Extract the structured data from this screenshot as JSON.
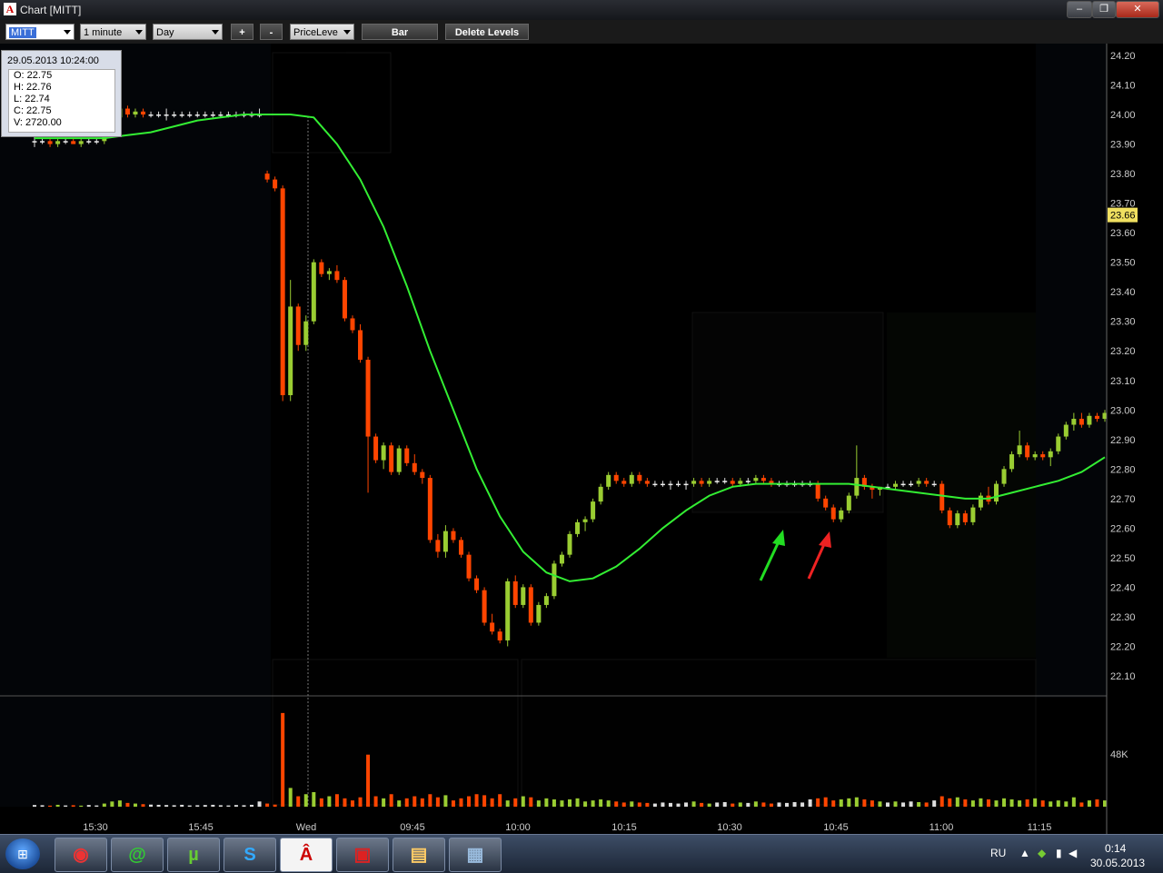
{
  "window": {
    "title": "Chart [MITT]",
    "app_icon": "A"
  },
  "toolbar": {
    "symbol": "MITT",
    "interval": "1 minute",
    "period": "Day",
    "zoom_in": "+",
    "zoom_out": "-",
    "mode": "PriceLeve",
    "bar_button": "Bar",
    "delete_levels_button": "Delete Levels"
  },
  "tooltip": {
    "datetime": "29.05.2013 10:24:00",
    "open": "O: 22.75",
    "high": "H: 22.76",
    "low": "L: 22.74",
    "close": "C: 22.75",
    "volume": "V: 2720.00"
  },
  "price_axis": {
    "labels": [
      "24.20",
      "24.10",
      "24.00",
      "23.90",
      "23.80",
      "23.70",
      "23.60",
      "23.50",
      "23.40",
      "23.30",
      "23.20",
      "23.10",
      "23.00",
      "22.90",
      "22.80",
      "22.70",
      "22.60",
      "22.50",
      "22.40",
      "22.30",
      "22.20",
      "22.10"
    ],
    "current_price": "23.66",
    "volume_label": "48K"
  },
  "time_axis": {
    "labels": [
      "15:30",
      "15:45",
      "Wed",
      "09:45",
      "10:00",
      "10:15",
      "10:30",
      "10:45",
      "11:00",
      "11:15"
    ]
  },
  "taskbar": {
    "language": "RU",
    "time": "0:14",
    "date": "30.05.2013"
  },
  "colors": {
    "up": "#9acd32",
    "down": "#ff4500",
    "ma": "#33ee33",
    "arrow_up": "#22dd22",
    "arrow_down": "#ee2222"
  },
  "chart_data": {
    "type": "candlestick",
    "symbol": "MITT",
    "ylim": [
      22.05,
      24.25
    ],
    "candles": [
      {
        "o": 23.91,
        "h": 23.93,
        "l": 23.89,
        "c": 23.91
      },
      {
        "o": 23.91,
        "h": 23.92,
        "l": 23.9,
        "c": 23.91
      },
      {
        "o": 23.91,
        "h": 23.92,
        "l": 23.89,
        "c": 23.9
      },
      {
        "o": 23.9,
        "h": 23.92,
        "l": 23.89,
        "c": 23.91
      },
      {
        "o": 23.91,
        "h": 23.92,
        "l": 23.9,
        "c": 23.91
      },
      {
        "o": 23.91,
        "h": 23.92,
        "l": 23.9,
        "c": 23.9
      },
      {
        "o": 23.9,
        "h": 23.92,
        "l": 23.89,
        "c": 23.91
      },
      {
        "o": 23.91,
        "h": 23.92,
        "l": 23.9,
        "c": 23.91
      },
      {
        "o": 23.91,
        "h": 23.92,
        "l": 23.9,
        "c": 23.91
      },
      {
        "o": 23.91,
        "h": 23.97,
        "l": 23.9,
        "c": 23.96
      },
      {
        "o": 23.96,
        "h": 24.0,
        "l": 23.95,
        "c": 23.99
      },
      {
        "o": 23.99,
        "h": 24.03,
        "l": 23.98,
        "c": 24.02
      },
      {
        "o": 24.02,
        "h": 24.03,
        "l": 23.99,
        "c": 24.0
      },
      {
        "o": 24.0,
        "h": 24.02,
        "l": 23.99,
        "c": 24.01
      },
      {
        "o": 24.01,
        "h": 24.02,
        "l": 23.99,
        "c": 24.0
      },
      {
        "o": 24.0,
        "h": 24.01,
        "l": 23.99,
        "c": 24.0
      },
      {
        "o": 24.0,
        "h": 24.01,
        "l": 23.99,
        "c": 24.0
      },
      {
        "o": 24.0,
        "h": 24.02,
        "l": 23.98,
        "c": 24.0
      },
      {
        "o": 24.0,
        "h": 24.01,
        "l": 23.99,
        "c": 24.0
      },
      {
        "o": 24.0,
        "h": 24.01,
        "l": 23.99,
        "c": 24.0
      },
      {
        "o": 24.0,
        "h": 24.01,
        "l": 23.99,
        "c": 24.0
      },
      {
        "o": 24.0,
        "h": 24.01,
        "l": 23.99,
        "c": 24.0
      },
      {
        "o": 24.0,
        "h": 24.01,
        "l": 23.99,
        "c": 24.0
      },
      {
        "o": 24.0,
        "h": 24.01,
        "l": 23.99,
        "c": 24.0
      },
      {
        "o": 24.0,
        "h": 24.01,
        "l": 23.99,
        "c": 24.0
      },
      {
        "o": 24.0,
        "h": 24.01,
        "l": 23.99,
        "c": 24.0
      },
      {
        "o": 24.0,
        "h": 24.01,
        "l": 23.99,
        "c": 24.0
      },
      {
        "o": 24.0,
        "h": 24.01,
        "l": 23.99,
        "c": 24.0
      },
      {
        "o": 24.0,
        "h": 24.01,
        "l": 23.99,
        "c": 24.0
      },
      {
        "o": 24.0,
        "h": 24.02,
        "l": 23.99,
        "c": 24.0
      },
      {
        "o": 23.8,
        "h": 23.81,
        "l": 23.77,
        "c": 23.78
      },
      {
        "o": 23.78,
        "h": 23.79,
        "l": 23.74,
        "c": 23.75
      },
      {
        "o": 23.75,
        "h": 23.76,
        "l": 23.03,
        "c": 23.05
      },
      {
        "o": 23.05,
        "h": 23.44,
        "l": 23.03,
        "c": 23.35
      },
      {
        "o": 23.35,
        "h": 23.36,
        "l": 23.2,
        "c": 23.22
      },
      {
        "o": 23.22,
        "h": 23.32,
        "l": 23.2,
        "c": 23.3
      },
      {
        "o": 23.3,
        "h": 23.51,
        "l": 23.29,
        "c": 23.5
      },
      {
        "o": 23.5,
        "h": 23.51,
        "l": 23.45,
        "c": 23.46
      },
      {
        "o": 23.46,
        "h": 23.48,
        "l": 23.44,
        "c": 23.47
      },
      {
        "o": 23.47,
        "h": 23.49,
        "l": 23.43,
        "c": 23.44
      },
      {
        "o": 23.44,
        "h": 23.45,
        "l": 23.3,
        "c": 23.31
      },
      {
        "o": 23.31,
        "h": 23.32,
        "l": 23.26,
        "c": 23.27
      },
      {
        "o": 23.27,
        "h": 23.29,
        "l": 23.16,
        "c": 23.17
      },
      {
        "o": 23.17,
        "h": 23.18,
        "l": 22.72,
        "c": 22.91
      },
      {
        "o": 22.91,
        "h": 22.92,
        "l": 22.82,
        "c": 22.83
      },
      {
        "o": 22.83,
        "h": 22.89,
        "l": 22.8,
        "c": 22.88
      },
      {
        "o": 22.88,
        "h": 22.89,
        "l": 22.78,
        "c": 22.79
      },
      {
        "o": 22.79,
        "h": 22.88,
        "l": 22.78,
        "c": 22.87
      },
      {
        "o": 22.87,
        "h": 22.88,
        "l": 22.81,
        "c": 22.82
      },
      {
        "o": 22.82,
        "h": 22.85,
        "l": 22.78,
        "c": 22.79
      },
      {
        "o": 22.79,
        "h": 22.8,
        "l": 22.75,
        "c": 22.77
      },
      {
        "o": 22.77,
        "h": 22.78,
        "l": 22.55,
        "c": 22.56
      },
      {
        "o": 22.56,
        "h": 22.58,
        "l": 22.5,
        "c": 22.52
      },
      {
        "o": 22.52,
        "h": 22.61,
        "l": 22.5,
        "c": 22.59
      },
      {
        "o": 22.59,
        "h": 22.6,
        "l": 22.55,
        "c": 22.56
      },
      {
        "o": 22.56,
        "h": 22.57,
        "l": 22.5,
        "c": 22.51
      },
      {
        "o": 22.51,
        "h": 22.52,
        "l": 22.42,
        "c": 22.43
      },
      {
        "o": 22.43,
        "h": 22.44,
        "l": 22.38,
        "c": 22.39
      },
      {
        "o": 22.39,
        "h": 22.4,
        "l": 22.27,
        "c": 22.28
      },
      {
        "o": 22.28,
        "h": 22.31,
        "l": 22.24,
        "c": 22.25
      },
      {
        "o": 22.25,
        "h": 22.26,
        "l": 22.21,
        "c": 22.22
      },
      {
        "o": 22.22,
        "h": 22.43,
        "l": 22.2,
        "c": 22.42
      },
      {
        "o": 22.42,
        "h": 22.44,
        "l": 22.33,
        "c": 22.34
      },
      {
        "o": 22.34,
        "h": 22.41,
        "l": 22.33,
        "c": 22.4
      },
      {
        "o": 22.4,
        "h": 22.41,
        "l": 22.27,
        "c": 22.28
      },
      {
        "o": 22.28,
        "h": 22.35,
        "l": 22.27,
        "c": 22.34
      },
      {
        "o": 22.34,
        "h": 22.38,
        "l": 22.33,
        "c": 22.37
      },
      {
        "o": 22.37,
        "h": 22.49,
        "l": 22.36,
        "c": 22.48
      },
      {
        "o": 22.48,
        "h": 22.52,
        "l": 22.47,
        "c": 22.51
      },
      {
        "o": 22.51,
        "h": 22.59,
        "l": 22.5,
        "c": 22.58
      },
      {
        "o": 22.58,
        "h": 22.63,
        "l": 22.57,
        "c": 22.62
      },
      {
        "o": 22.62,
        "h": 22.64,
        "l": 22.59,
        "c": 22.63
      },
      {
        "o": 22.63,
        "h": 22.7,
        "l": 22.62,
        "c": 22.69
      },
      {
        "o": 22.69,
        "h": 22.75,
        "l": 22.68,
        "c": 22.74
      },
      {
        "o": 22.74,
        "h": 22.79,
        "l": 22.73,
        "c": 22.78
      },
      {
        "o": 22.78,
        "h": 22.79,
        "l": 22.75,
        "c": 22.76
      },
      {
        "o": 22.76,
        "h": 22.77,
        "l": 22.74,
        "c": 22.75
      },
      {
        "o": 22.75,
        "h": 22.79,
        "l": 22.74,
        "c": 22.78
      },
      {
        "o": 22.78,
        "h": 22.79,
        "l": 22.75,
        "c": 22.76
      },
      {
        "o": 22.76,
        "h": 22.77,
        "l": 22.74,
        "c": 22.75
      },
      {
        "o": 22.75,
        "h": 22.76,
        "l": 22.74,
        "c": 22.75
      },
      {
        "o": 22.75,
        "h": 22.76,
        "l": 22.74,
        "c": 22.75
      },
      {
        "o": 22.75,
        "h": 22.76,
        "l": 22.73,
        "c": 22.75
      },
      {
        "o": 22.75,
        "h": 22.76,
        "l": 22.74,
        "c": 22.75
      },
      {
        "o": 22.75,
        "h": 22.76,
        "l": 22.73,
        "c": 22.75
      },
      {
        "o": 22.75,
        "h": 22.77,
        "l": 22.74,
        "c": 22.76
      },
      {
        "o": 22.76,
        "h": 22.77,
        "l": 22.74,
        "c": 22.75
      },
      {
        "o": 22.75,
        "h": 22.77,
        "l": 22.74,
        "c": 22.76
      },
      {
        "o": 22.76,
        "h": 22.77,
        "l": 22.75,
        "c": 22.76
      },
      {
        "o": 22.76,
        "h": 22.77,
        "l": 22.75,
        "c": 22.76
      },
      {
        "o": 22.76,
        "h": 22.77,
        "l": 22.74,
        "c": 22.75
      },
      {
        "o": 22.75,
        "h": 22.77,
        "l": 22.74,
        "c": 22.76
      },
      {
        "o": 22.76,
        "h": 22.77,
        "l": 22.75,
        "c": 22.76
      },
      {
        "o": 22.76,
        "h": 22.78,
        "l": 22.75,
        "c": 22.77
      },
      {
        "o": 22.77,
        "h": 22.78,
        "l": 22.75,
        "c": 22.76
      },
      {
        "o": 22.76,
        "h": 22.77,
        "l": 22.74,
        "c": 22.75
      },
      {
        "o": 22.75,
        "h": 22.76,
        "l": 22.74,
        "c": 22.75
      },
      {
        "o": 22.75,
        "h": 22.76,
        "l": 22.74,
        "c": 22.75
      },
      {
        "o": 22.75,
        "h": 22.76,
        "l": 22.74,
        "c": 22.75
      },
      {
        "o": 22.75,
        "h": 22.76,
        "l": 22.74,
        "c": 22.75
      },
      {
        "o": 22.75,
        "h": 22.76,
        "l": 22.74,
        "c": 22.75
      },
      {
        "o": 22.75,
        "h": 22.76,
        "l": 22.69,
        "c": 22.7
      },
      {
        "o": 22.7,
        "h": 22.71,
        "l": 22.66,
        "c": 22.67
      },
      {
        "o": 22.67,
        "h": 22.68,
        "l": 22.62,
        "c": 22.63
      },
      {
        "o": 22.63,
        "h": 22.67,
        "l": 22.62,
        "c": 22.66
      },
      {
        "o": 22.66,
        "h": 22.72,
        "l": 22.65,
        "c": 22.71
      },
      {
        "o": 22.71,
        "h": 22.88,
        "l": 22.7,
        "c": 22.77
      },
      {
        "o": 22.77,
        "h": 22.78,
        "l": 22.73,
        "c": 22.74
      },
      {
        "o": 22.74,
        "h": 22.75,
        "l": 22.7,
        "c": 22.73
      },
      {
        "o": 22.73,
        "h": 22.74,
        "l": 22.71,
        "c": 22.74
      },
      {
        "o": 22.74,
        "h": 22.75,
        "l": 22.73,
        "c": 22.74
      },
      {
        "o": 22.74,
        "h": 22.76,
        "l": 22.73,
        "c": 22.75
      },
      {
        "o": 22.75,
        "h": 22.76,
        "l": 22.74,
        "c": 22.75
      },
      {
        "o": 22.75,
        "h": 22.76,
        "l": 22.74,
        "c": 22.75
      },
      {
        "o": 22.75,
        "h": 22.77,
        "l": 22.74,
        "c": 22.76
      },
      {
        "o": 22.76,
        "h": 22.77,
        "l": 22.74,
        "c": 22.75
      },
      {
        "o": 22.75,
        "h": 22.76,
        "l": 22.74,
        "c": 22.75
      },
      {
        "o": 22.75,
        "h": 22.76,
        "l": 22.65,
        "c": 22.66
      },
      {
        "o": 22.66,
        "h": 22.67,
        "l": 22.6,
        "c": 22.61
      },
      {
        "o": 22.61,
        "h": 22.66,
        "l": 22.6,
        "c": 22.65
      },
      {
        "o": 22.65,
        "h": 22.66,
        "l": 22.61,
        "c": 22.62
      },
      {
        "o": 22.62,
        "h": 22.68,
        "l": 22.61,
        "c": 22.67
      },
      {
        "o": 22.67,
        "h": 22.72,
        "l": 22.66,
        "c": 22.71
      },
      {
        "o": 22.71,
        "h": 22.74,
        "l": 22.68,
        "c": 22.69
      },
      {
        "o": 22.69,
        "h": 22.76,
        "l": 22.68,
        "c": 22.75
      },
      {
        "o": 22.75,
        "h": 22.81,
        "l": 22.74,
        "c": 22.8
      },
      {
        "o": 22.8,
        "h": 22.86,
        "l": 22.79,
        "c": 22.85
      },
      {
        "o": 22.85,
        "h": 22.93,
        "l": 22.84,
        "c": 22.88
      },
      {
        "o": 22.88,
        "h": 22.89,
        "l": 22.83,
        "c": 22.84
      },
      {
        "o": 22.84,
        "h": 22.86,
        "l": 22.83,
        "c": 22.85
      },
      {
        "o": 22.85,
        "h": 22.86,
        "l": 22.83,
        "c": 22.84
      },
      {
        "o": 22.84,
        "h": 22.87,
        "l": 22.81,
        "c": 22.86
      },
      {
        "o": 22.86,
        "h": 22.92,
        "l": 22.85,
        "c": 22.91
      },
      {
        "o": 22.91,
        "h": 22.96,
        "l": 22.9,
        "c": 22.95
      },
      {
        "o": 22.95,
        "h": 22.99,
        "l": 22.93,
        "c": 22.97
      },
      {
        "o": 22.97,
        "h": 22.99,
        "l": 22.94,
        "c": 22.95
      },
      {
        "o": 22.95,
        "h": 22.99,
        "l": 22.94,
        "c": 22.98
      },
      {
        "o": 22.98,
        "h": 22.99,
        "l": 22.96,
        "c": 22.97
      },
      {
        "o": 22.97,
        "h": 23.0,
        "l": 22.96,
        "c": 22.99
      }
    ],
    "moving_average": [
      23.92,
      23.92,
      23.92,
      23.92,
      23.93,
      23.94,
      23.96,
      23.98,
      23.99,
      24.0,
      24.0,
      24.0,
      23.99,
      23.9,
      23.78,
      23.62,
      23.42,
      23.2,
      23.0,
      22.8,
      22.64,
      22.52,
      22.45,
      22.42,
      22.43,
      22.47,
      22.53,
      22.6,
      22.66,
      22.71,
      22.74,
      22.75,
      22.75,
      22.75,
      22.75,
      22.75,
      22.74,
      22.73,
      22.72,
      22.71,
      22.7,
      22.7,
      22.72,
      22.74,
      22.76,
      22.79,
      22.84
    ],
    "volume_ylim": [
      0,
      48000
    ],
    "volumes": [
      800,
      700,
      500,
      900,
      600,
      700,
      500,
      800,
      600,
      1500,
      2500,
      3000,
      1800,
      1500,
      1200,
      1000,
      900,
      800,
      700,
      900,
      600,
      700,
      800,
      900,
      700,
      600,
      800,
      700,
      900,
      2500,
      1500,
      1000,
      45000,
      9000,
      5000,
      6000,
      7000,
      4000,
      5000,
      6000,
      4000,
      3000,
      4500,
      25000,
      5000,
      4000,
      6000,
      3000,
      4000,
      5000,
      4000,
      6000,
      4500,
      5500,
      3000,
      4000,
      5000,
      6000,
      5500,
      4000,
      6000,
      3000,
      4000,
      5000,
      4500,
      3000,
      4000,
      3500,
      3000,
      3500,
      4000,
      2500,
      3000,
      3500,
      3000,
      2500,
      2000,
      2500,
      2000,
      1800,
      1500,
      2000,
      1800,
      1500,
      2000,
      2500,
      1800,
      1500,
      2000,
      2200,
      1500,
      2000,
      1800,
      2500,
      2000,
      1500,
      2000,
      1800,
      2200,
      2000,
      3500,
      4000,
      4500,
      3000,
      3500,
      4000,
      4500,
      3500,
      3000,
      2500,
      2000,
      2500,
      2000,
      2500,
      2200,
      2000,
      3000,
      5000,
      4000,
      4500,
      3500,
      3000,
      4000,
      3500,
      3000,
      4000,
      3500,
      3000,
      3500,
      4000,
      3000,
      2500,
      3000,
      2500,
      4500,
      2000,
      3000,
      3500,
      3000
    ],
    "annotations": [
      "green-arrow-up",
      "red-arrow-up"
    ]
  }
}
